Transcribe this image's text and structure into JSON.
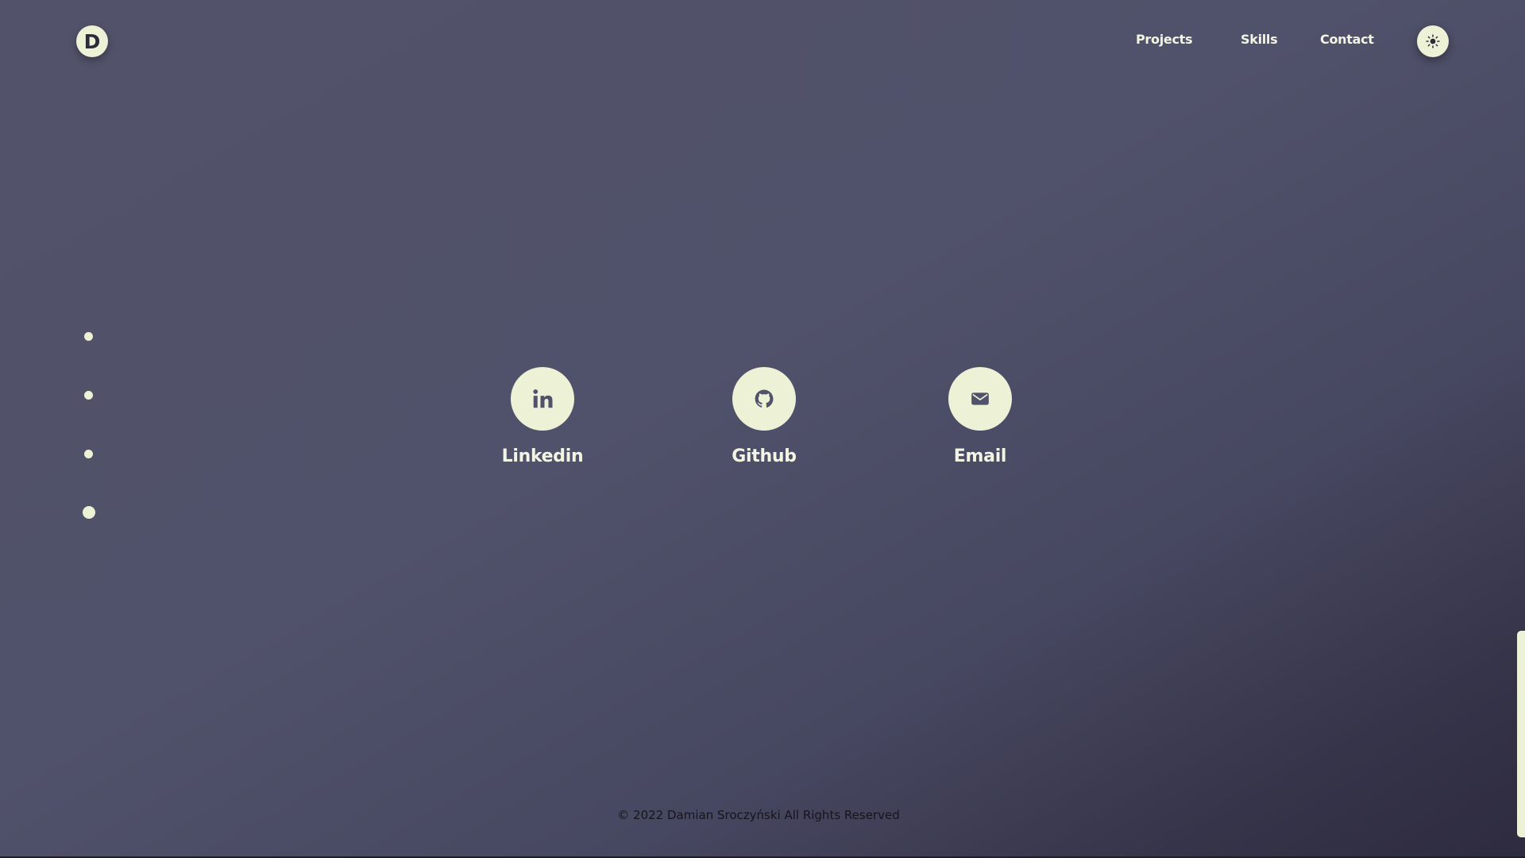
{
  "header": {
    "logo_letter": "D",
    "nav": [
      {
        "label": "Projects"
      },
      {
        "label": "Skills"
      },
      {
        "label": "Contact"
      }
    ],
    "theme_toggle_icon": "sun-icon"
  },
  "section_nav": {
    "dots": 4,
    "active_index": 3
  },
  "contact": {
    "items": [
      {
        "label": "Linkedin",
        "icon": "linkedin-icon"
      },
      {
        "label": "Github",
        "icon": "github-icon"
      },
      {
        "label": "Email",
        "icon": "mail-icon"
      }
    ]
  },
  "footer": {
    "text": "© 2022 Damian Sroczyński All Rights Reserved"
  },
  "colors": {
    "background": "#50516a",
    "accent": "#edf1d6",
    "icon_fg": "#50516a"
  }
}
